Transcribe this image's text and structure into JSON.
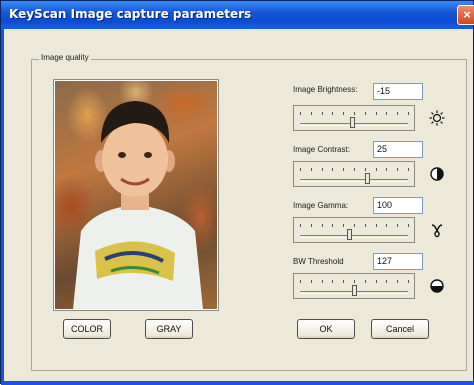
{
  "window": {
    "title": "KeyScan Image capture parameters",
    "close_glyph": "×"
  },
  "group": {
    "legend": "Image quality"
  },
  "image_buttons": {
    "color_label": "COLOR",
    "gray_label": "GRAY"
  },
  "dialog_buttons": {
    "ok_label": "OK",
    "cancel_label": "Cancel"
  },
  "controls": [
    {
      "label": "Image Brightness:",
      "value": "-15",
      "slider_fraction": 0.48,
      "icon": "sun-icon"
    },
    {
      "label": "Image Contrast:",
      "value": "25",
      "slider_fraction": 0.62,
      "icon": "contrast-icon"
    },
    {
      "label": "Image Gamma:",
      "value": "100",
      "slider_fraction": 0.45,
      "icon": "gamma-icon"
    },
    {
      "label": "BW Threshold",
      "value": "127",
      "slider_fraction": 0.5,
      "icon": "threshold-icon"
    }
  ],
  "colors": {
    "titlebar": "#1657d9",
    "dialog_bg": "#ece9d8"
  }
}
